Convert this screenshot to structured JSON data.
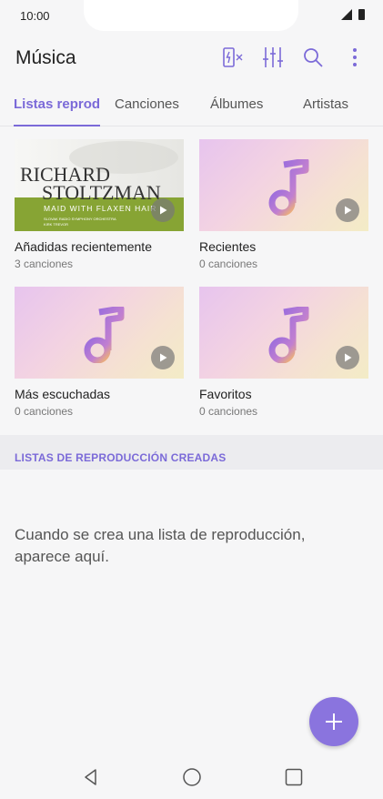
{
  "status": {
    "time": "10:00"
  },
  "header": {
    "title": "Música",
    "icons": [
      "battery-saver-icon",
      "equalizer-icon",
      "search-icon",
      "more-icon"
    ]
  },
  "tabs": [
    {
      "label": "Listas reprodu",
      "active": true
    },
    {
      "label": "Canciones",
      "active": false
    },
    {
      "label": "Álbumes",
      "active": false
    },
    {
      "label": "Artistas",
      "active": false
    }
  ],
  "playlists": [
    {
      "title": "Añadidas recientemente",
      "subtitle": "3 canciones",
      "art": {
        "line1": "RICHARD",
        "line2": "STOLTZMAN",
        "line3": "MAID WITH FLAXEN HAIR",
        "small1": "SLOVAK RADIO SYMPHONY ORCHESTRA",
        "small2": "KIRK TREVOR"
      }
    },
    {
      "title": "Recientes",
      "subtitle": "0 canciones"
    },
    {
      "title": "Más escuchadas",
      "subtitle": "0 canciones"
    },
    {
      "title": "Favoritos",
      "subtitle": "0 canciones"
    }
  ],
  "section": {
    "label": "LISTAS DE REPRODUCCIÓN CREADAS"
  },
  "empty_message": "Cuando se crea una lista de reproducción, aparece aquí.",
  "colors": {
    "accent": "#7b6ad8",
    "fab": "#8a74de",
    "background": "#f6f6f7"
  }
}
